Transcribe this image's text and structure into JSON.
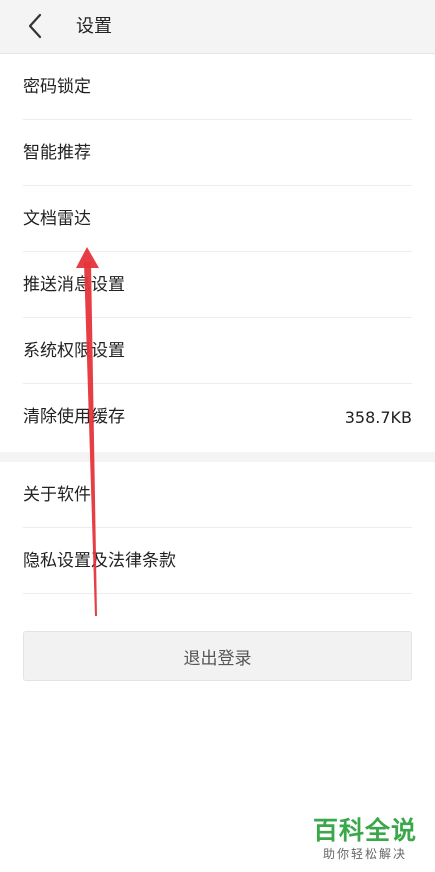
{
  "header": {
    "title": "设置",
    "back_icon": "chevron-left-icon"
  },
  "settings": {
    "group1": [
      {
        "label": "密码锁定",
        "value": ""
      },
      {
        "label": "智能推荐",
        "value": ""
      },
      {
        "label": "文档雷达",
        "value": ""
      },
      {
        "label": "推送消息设置",
        "value": ""
      },
      {
        "label": "系统权限设置",
        "value": ""
      },
      {
        "label": "清除使用缓存",
        "value": "358.7KB"
      }
    ],
    "group2": [
      {
        "label": "关于软件"
      },
      {
        "label": "隐私设置及法律条款"
      }
    ]
  },
  "logout": {
    "label": "退出登录"
  },
  "annotation": {
    "arrow_color": "#e5343a"
  },
  "watermark": {
    "main": "百科全说",
    "sub": "助你轻松解决"
  }
}
